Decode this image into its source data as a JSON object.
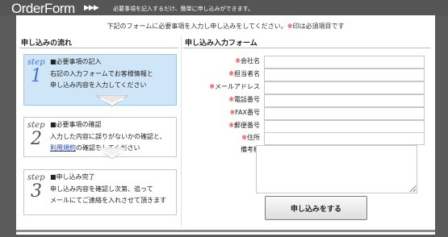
{
  "header": {
    "logo": "OrderForm",
    "arrows": "▶▶▶",
    "tagline": "必要事項を記入するだけ、簡単に申し込みができます。"
  },
  "instruction": {
    "pre": "下記のフォームに必要事項を入力し申し込みをしてください。",
    "mark": "※",
    "post": "印は必須項目です"
  },
  "flow": {
    "heading": "申し込みの流れ",
    "steps": [
      {
        "label": "step",
        "num": "1",
        "title": "■必要事項の記入",
        "desc1": "右記の入力フォームでお客様情報と",
        "desc2": "申し込み内容を入力してください"
      },
      {
        "label": "step",
        "num": "2",
        "title": "■必要事項の確認",
        "desc1": "入力した内容に誤りがないかの確認と、",
        "link": "利用規約",
        "desc2": "の確認をしてください"
      },
      {
        "label": "step",
        "num": "3",
        "title": "■申し込み完了",
        "desc1": "申し込み内容を確認し次第、追って",
        "desc2": "メールにてご連絡を入れさせて頂きます"
      }
    ]
  },
  "form": {
    "heading": "申し込み入力フォーム",
    "required_mark": "※",
    "fields": [
      {
        "label": "会社名",
        "required": true,
        "value": ""
      },
      {
        "label": "担当者名",
        "required": true,
        "value": ""
      },
      {
        "label": "メールアドレス",
        "required": true,
        "value": ""
      },
      {
        "label": "電話番号",
        "required": true,
        "value": ""
      },
      {
        "label": "FAX番号",
        "required": true,
        "value": ""
      },
      {
        "label": "郵便番号",
        "required": true,
        "value": ""
      },
      {
        "label": "住所",
        "required": true,
        "value": ""
      }
    ],
    "notes_label": "備考欄",
    "submit_label": "申し込みをする"
  }
}
